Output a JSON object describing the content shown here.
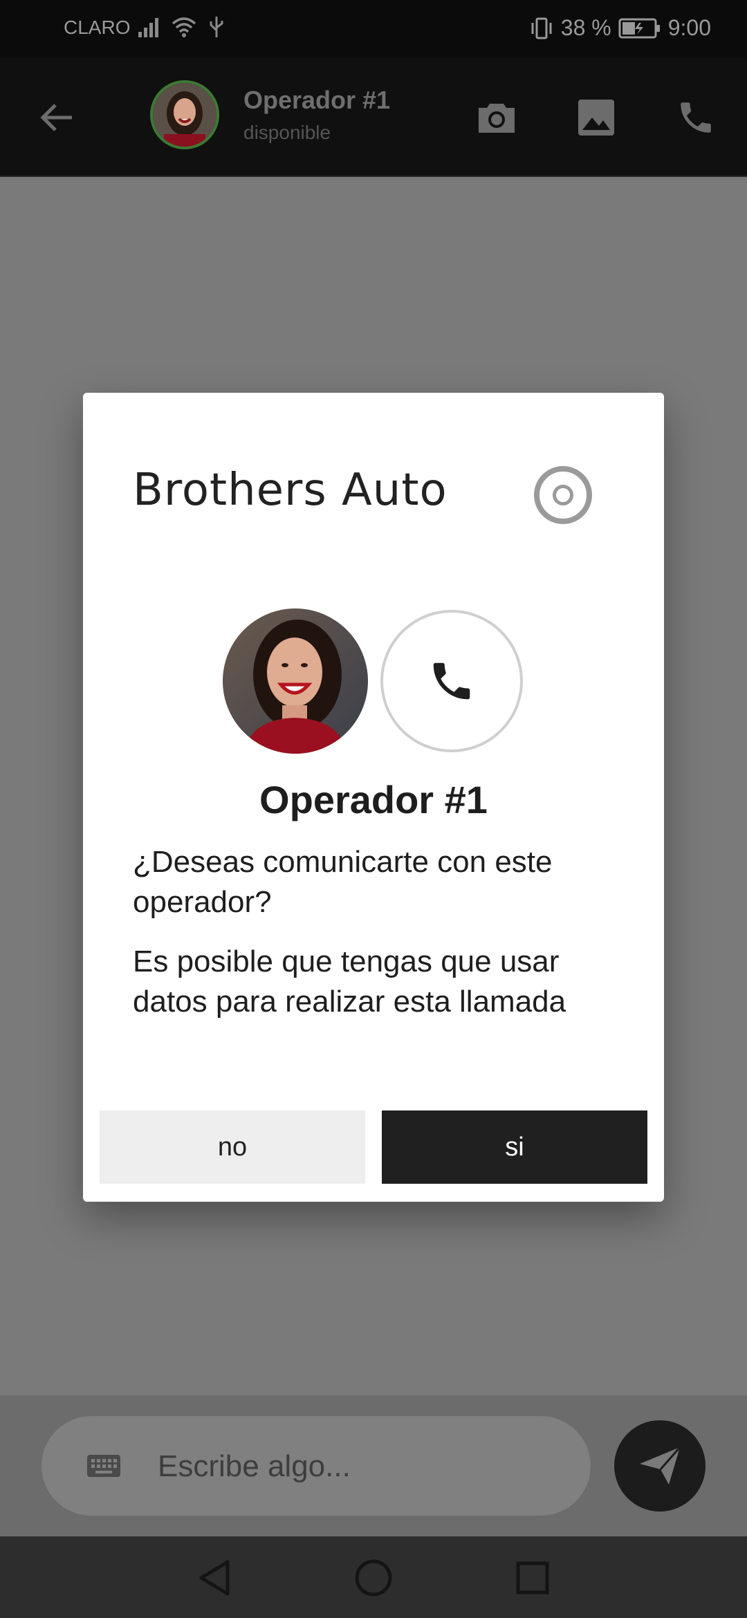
{
  "status_bar": {
    "carrier": "CLARO",
    "battery": "38 %",
    "time": "9:00",
    "icons": [
      "signal-icon",
      "wifi-icon",
      "usb-icon",
      "vibrate-icon",
      "battery-icon"
    ]
  },
  "app_bar": {
    "title": "Operador #1",
    "subtitle": "disponible",
    "icons": [
      "back-arrow-icon",
      "camera-icon",
      "image-icon",
      "phone-icon"
    ],
    "avatar_ring_color": "#3d7a33"
  },
  "composer": {
    "placeholder": "Escribe algo...",
    "icons": [
      "keyboard-icon",
      "send-icon"
    ]
  },
  "nav_bar": {
    "icons": [
      "back-triangle-icon",
      "home-circle-icon",
      "recents-square-icon"
    ]
  },
  "dialog": {
    "brand": "Brothers Auto",
    "operator_name": "Operador #1",
    "question": "¿Deseas comunicarte con este operador?",
    "note": "Es posible que tengas que usar datos para realizar esta llamada",
    "no_label": "no",
    "yes_label": "si",
    "icons": [
      "target-logo-icon",
      "phone-icon"
    ]
  },
  "colors": {
    "backdrop": "#7a7a7a",
    "dialog_bg": "#ffffff",
    "primary_button": "#202020",
    "secondary_button": "#eeeeee"
  }
}
